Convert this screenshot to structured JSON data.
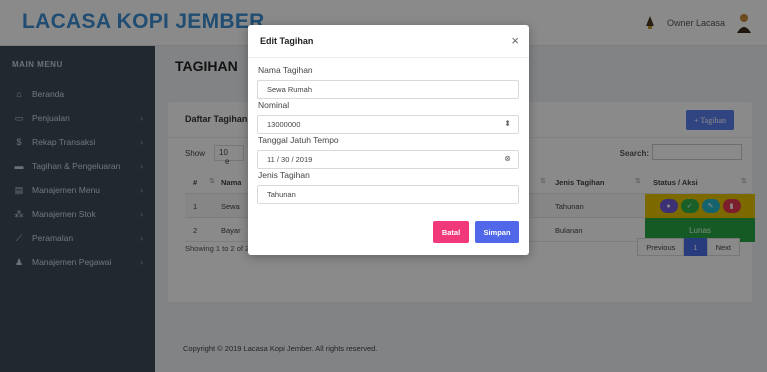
{
  "brand": "LACASA KOPI JEMBER",
  "user": {
    "name": "Owner Lacasa"
  },
  "sidebar": {
    "heading": "MAIN MENU",
    "items": [
      {
        "label": "Beranda",
        "icon": "home-icon",
        "has_chevron": false
      },
      {
        "label": "Penjualan",
        "icon": "cash-icon",
        "has_chevron": true
      },
      {
        "label": "Rekap Transaksi",
        "icon": "dollar-icon",
        "has_chevron": true
      },
      {
        "label": "Tagihan & Pengeluaran",
        "icon": "wallet-icon",
        "has_chevron": true
      },
      {
        "label": "Manajemen Menu",
        "icon": "menu-card-icon",
        "has_chevron": true
      },
      {
        "label": "Manajemen Stok",
        "icon": "stock-icon",
        "has_chevron": true
      },
      {
        "label": "Peramalan",
        "icon": "chart-icon",
        "has_chevron": true
      },
      {
        "label": "Manajemen Pegawai",
        "icon": "users-icon",
        "has_chevron": true
      }
    ]
  },
  "main": {
    "page_title": "TAGIHAN",
    "card_title": "Daftar Tagihan",
    "add_button": "+ Tagihan",
    "show_label": "Show",
    "show_value": "10",
    "show_suffix": "e",
    "search_label": "Search:",
    "table": {
      "headers": [
        "#",
        "Nama",
        "Jenis Tagihan",
        "Status / Aksi"
      ],
      "rows": [
        {
          "no": "1",
          "nama": "Sewa",
          "jenis": "Tahunan",
          "status": ""
        },
        {
          "no": "2",
          "nama": "Bayar",
          "jenis": "Bulanan",
          "status": "Lunas"
        }
      ]
    },
    "entries_info": "Showing 1 to 2 of 2 entries",
    "pager": {
      "prev": "Previous",
      "page": "1",
      "next": "Next"
    },
    "footer": "Copyright © 2019 Lacasa Kopi Jember. All rights reserved."
  },
  "modal": {
    "title": "Edit Tagihan",
    "close": "×",
    "fields": [
      {
        "label": "Nama Tagihan",
        "value": "Sewa Rumah"
      },
      {
        "label": "Nominal",
        "value": "13000000"
      },
      {
        "label": "Tanggal Jatuh Tempo",
        "value": "11 / 30 / 2019"
      },
      {
        "label": "Jenis Tagihan",
        "value": "Tahunan"
      }
    ],
    "cancel_button": "Batal",
    "save_button": "Simpan"
  },
  "colors": {
    "brand": "#3b8fd1",
    "sidebar": "#3f4a58",
    "primary": "#4f67e8",
    "danger": "#f0387a",
    "status_pending": "#e6c200",
    "status_paid": "#28a745"
  }
}
